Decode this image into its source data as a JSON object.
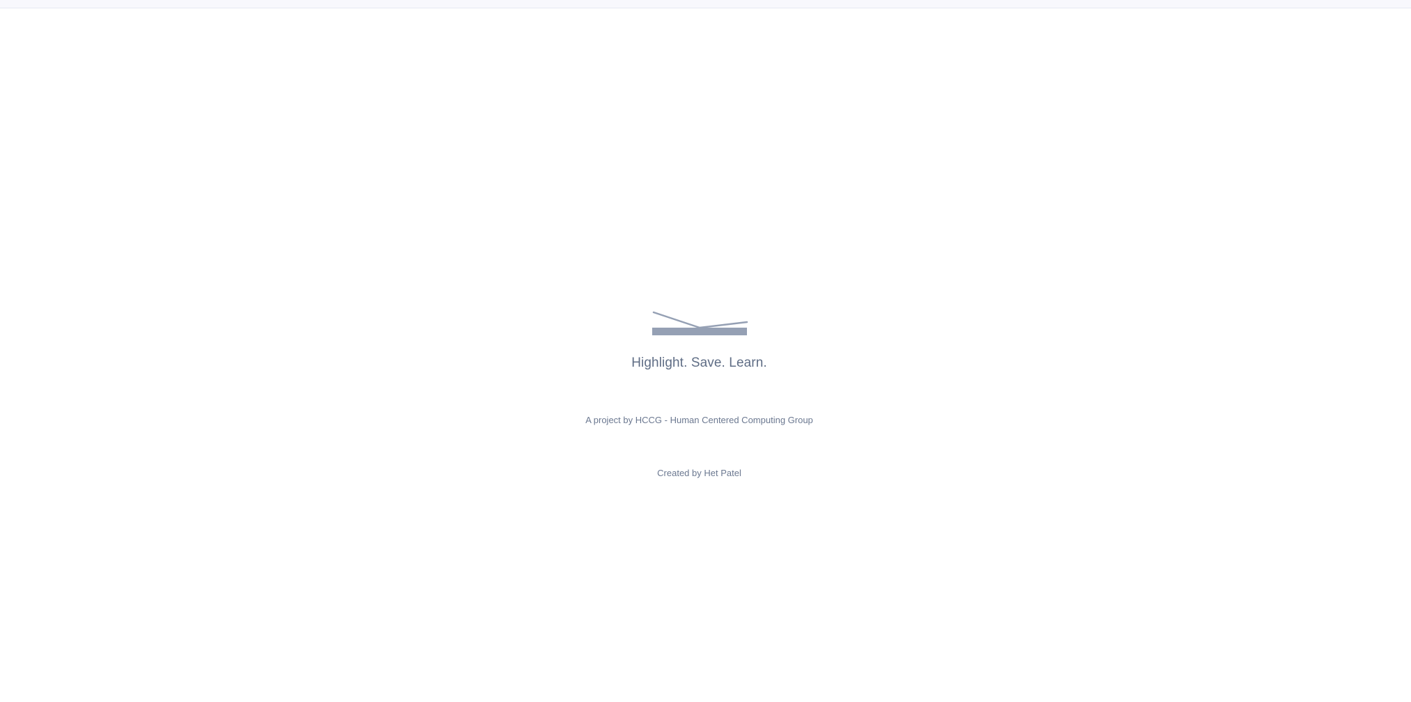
{
  "app": {
    "tagline": "Highlight. Save. Learn.",
    "project_credit": "A project by HCCG - Human Centered Computing Group",
    "creator_credit": "Created by Het Patel"
  },
  "logo": {
    "icon": "open-book-icon",
    "color": "#95a0b4"
  }
}
